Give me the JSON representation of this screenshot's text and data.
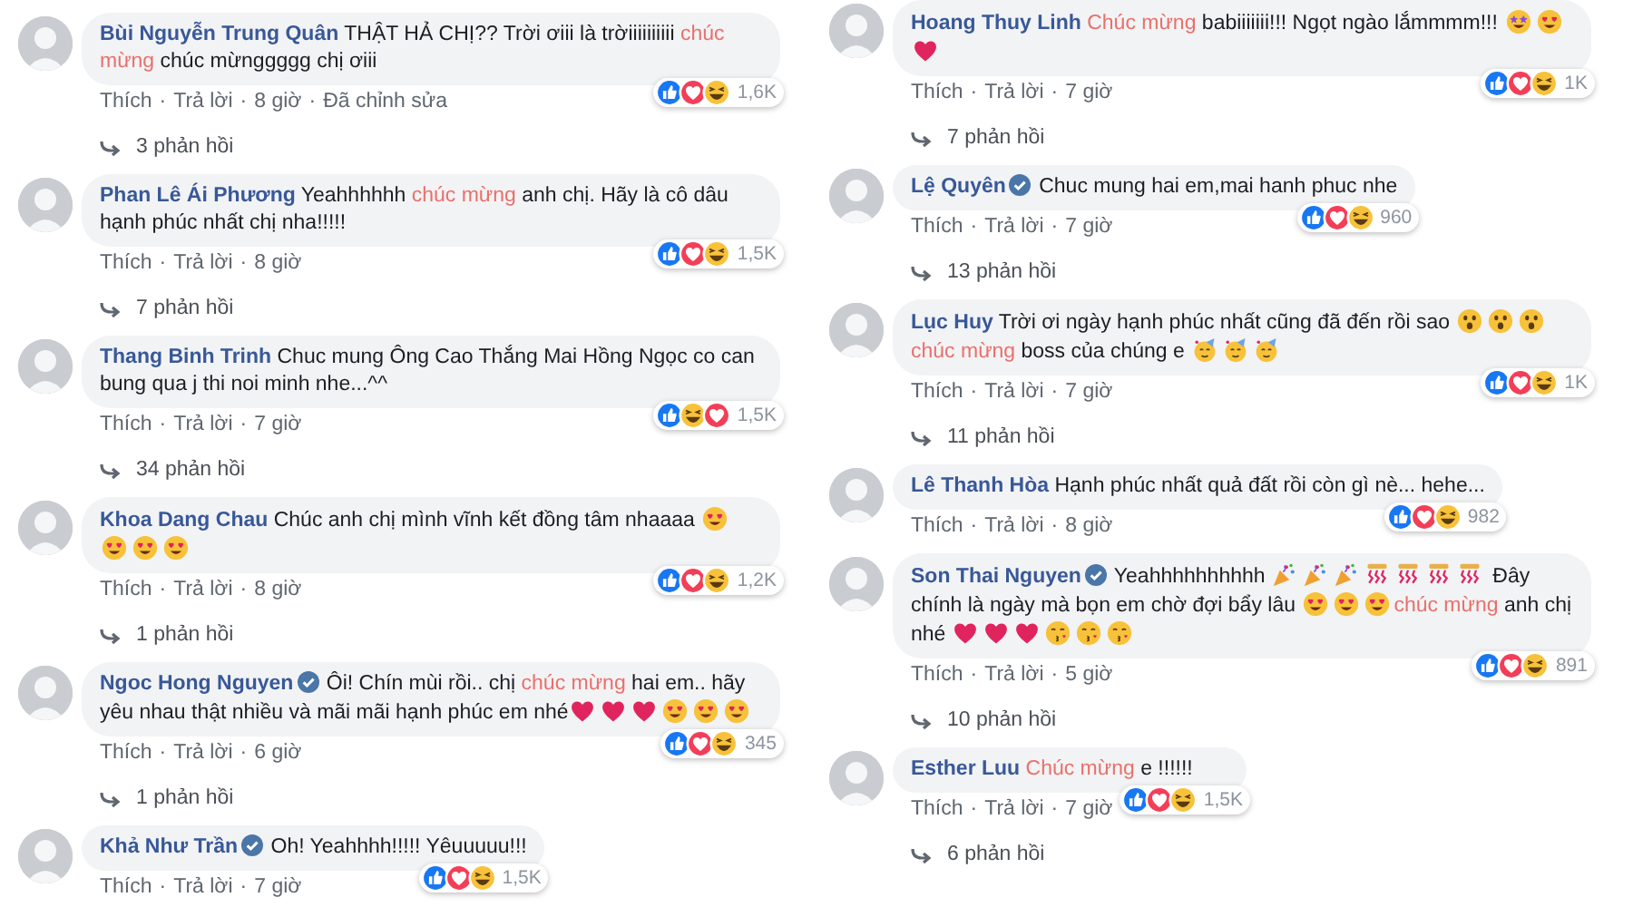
{
  "columns": [
    {
      "comments": [
        {
          "name": "Bùi Nguyễn Trung Quân",
          "verified": false,
          "body": [
            {
              "kind": "text",
              "text": "THẬT HẢ CHỊ?? Trời ơiii là trờiiiiiiiiii "
            },
            {
              "kind": "highlight",
              "text": "chúc mừng"
            },
            {
              "kind": "text",
              "text": " chúc mừnggggg chị ơiii"
            }
          ],
          "meta": [
            "Thích",
            "·",
            "Trả lời",
            "·",
            "8 giờ",
            "·",
            "Đã chỉnh sửa"
          ],
          "reactions": [
            {
              "kind": "like"
            },
            {
              "kind": "love"
            },
            {
              "kind": "haha"
            }
          ],
          "count": "1,6K",
          "replies": "3 phản hồi"
        },
        {
          "name": "Phan Lê Ái Phương",
          "verified": false,
          "body": [
            {
              "kind": "text",
              "text": "Yeahhhhhh "
            },
            {
              "kind": "highlight",
              "text": "chúc mừng"
            },
            {
              "kind": "text",
              "text": " anh chị. Hãy là cô dâu hạnh phúc nhất chị nha!!!!!"
            }
          ],
          "meta": [
            "Thích",
            "·",
            "Trả lời",
            "·",
            "8 giờ"
          ],
          "reactions": [
            {
              "kind": "like"
            },
            {
              "kind": "love"
            },
            {
              "kind": "haha"
            }
          ],
          "count": "1,5K",
          "replies": "7 phản hồi"
        },
        {
          "name": "Thang Binh Trinh",
          "verified": false,
          "body": [
            {
              "kind": "text",
              "text": "Chuc mung Ông Cao Thắng Mai Hồng Ngọc co can bung qua j thi noi minh nhe...^^"
            }
          ],
          "meta": [
            "Thích",
            "·",
            "Trả lời",
            "·",
            "7 giờ"
          ],
          "reactions": [
            {
              "kind": "like"
            },
            {
              "kind": "haha"
            },
            {
              "kind": "love"
            }
          ],
          "count": "1,5K",
          "replies": "34 phản hồi"
        },
        {
          "name": "Khoa Dang Chau",
          "verified": false,
          "body": [
            {
              "kind": "text",
              "text": "Chúc anh chị mình vĩnh kết đồng tâm nhaaaa "
            },
            {
              "kind": "heart-eyes"
            },
            {
              "kind": "heart-eyes"
            },
            {
              "kind": "heart-eyes"
            },
            {
              "kind": "heart-eyes"
            }
          ],
          "meta": [
            "Thích",
            "·",
            "Trả lời",
            "·",
            "8 giờ"
          ],
          "reactions": [
            {
              "kind": "like"
            },
            {
              "kind": "love"
            },
            {
              "kind": "haha"
            }
          ],
          "count": "1,2K",
          "replies": "1 phản hồi"
        },
        {
          "name": "Ngoc Hong Nguyen",
          "verified": true,
          "body": [
            {
              "kind": "text",
              "text": "Ôi! Chín mùi rồi.. chị "
            },
            {
              "kind": "highlight",
              "text": "chúc mừng"
            },
            {
              "kind": "text",
              "text": " hai em.. hãy yêu nhau thật nhiều và mãi mãi hạnh phúc em nhé"
            },
            {
              "kind": "heart"
            },
            {
              "kind": "heart"
            },
            {
              "kind": "heart"
            },
            {
              "kind": "heart-eyes"
            },
            {
              "kind": "heart-eyes"
            },
            {
              "kind": "heart-eyes"
            }
          ],
          "meta": [
            "Thích",
            "·",
            "Trả lời",
            "·",
            "6 giờ"
          ],
          "reactions": [
            {
              "kind": "like"
            },
            {
              "kind": "love"
            },
            {
              "kind": "haha"
            }
          ],
          "count": "345",
          "replies": "1 phản hồi"
        },
        {
          "name": "Khả Như Trần",
          "verified": true,
          "body": [
            {
              "kind": "text",
              "text": "Oh! Yeahhhh!!!!! Yêuuuuu!!!"
            }
          ],
          "meta": [
            "Thích",
            "·",
            "Trả lời",
            "·",
            "7 giờ"
          ],
          "reactions": [
            {
              "kind": "like"
            },
            {
              "kind": "love"
            },
            {
              "kind": "haha"
            }
          ],
          "count": "1,5K"
        }
      ]
    },
    {
      "comments": [
        {
          "name": "Hoang Thuy Linh",
          "verified": false,
          "body": [
            {
              "kind": "highlight",
              "text": "Chúc mừng"
            },
            {
              "kind": "text",
              "text": " babiiiiiii!!! Ngọt ngào lắmmmm!!! "
            },
            {
              "kind": "star-eyes"
            },
            {
              "kind": "heart-eyes"
            },
            {
              "kind": "heart"
            }
          ],
          "meta": [
            "Thích",
            "·",
            "Trả lời",
            "·",
            "7 giờ"
          ],
          "reactions": [
            {
              "kind": "like"
            },
            {
              "kind": "love"
            },
            {
              "kind": "haha"
            }
          ],
          "count": "1K",
          "replies": "7 phản hồi"
        },
        {
          "name": "Lệ Quyên",
          "verified": true,
          "body": [
            {
              "kind": "text",
              "text": "Chuc mung hai em,mai hanh phuc nhe"
            }
          ],
          "meta": [
            "Thích",
            "·",
            "Trả lời",
            "·",
            "7 giờ"
          ],
          "reactions": [
            {
              "kind": "like"
            },
            {
              "kind": "love"
            },
            {
              "kind": "haha"
            }
          ],
          "count": "960",
          "replies": "13 phản hồi"
        },
        {
          "name": "Lục Huy",
          "verified": false,
          "body": [
            {
              "kind": "text",
              "text": "Trời ơi ngày hạnh phúc nhất cũng đã đến rồi sao "
            },
            {
              "kind": "wow"
            },
            {
              "kind": "wow"
            },
            {
              "kind": "wow"
            },
            {
              "kind": "highlight",
              "text": "chúc mừng"
            },
            {
              "kind": "text",
              "text": " boss của chúng e "
            },
            {
              "kind": "party"
            },
            {
              "kind": "party"
            },
            {
              "kind": "party"
            }
          ],
          "meta": [
            "Thích",
            "·",
            "Trả lời",
            "·",
            "7 giờ"
          ],
          "reactions": [
            {
              "kind": "like"
            },
            {
              "kind": "love"
            },
            {
              "kind": "haha"
            }
          ],
          "count": "1K",
          "replies": "11 phản hồi"
        },
        {
          "name": "Lê Thanh Hòa",
          "verified": false,
          "body": [
            {
              "kind": "text",
              "text": "Hạnh phúc nhất quả đất rồi còn gì nè... hehe..."
            }
          ],
          "meta": [
            "Thích",
            "·",
            "Trả lời",
            "·",
            "8 giờ"
          ],
          "reactions": [
            {
              "kind": "like"
            },
            {
              "kind": "love"
            },
            {
              "kind": "haha"
            }
          ],
          "count": "982"
        },
        {
          "name": "Son Thai Nguyen",
          "verified": true,
          "body": [
            {
              "kind": "text",
              "text": "Yeahhhhhhhhhh "
            },
            {
              "kind": "popper"
            },
            {
              "kind": "popper"
            },
            {
              "kind": "popper"
            },
            {
              "kind": "streamer"
            },
            {
              "kind": "streamer"
            },
            {
              "kind": "streamer"
            },
            {
              "kind": "streamer"
            },
            {
              "kind": "text",
              "text": " Đây chính là ngày mà bọn em chờ đợi bẩy lâu "
            },
            {
              "kind": "heart-eyes"
            },
            {
              "kind": "heart-eyes"
            },
            {
              "kind": "heart-eyes"
            },
            {
              "kind": "highlight",
              "text": "chúc mừng"
            },
            {
              "kind": "text",
              "text": " anh chị nhé "
            },
            {
              "kind": "heart"
            },
            {
              "kind": "heart"
            },
            {
              "kind": "heart"
            },
            {
              "kind": "kiss"
            },
            {
              "kind": "kiss"
            },
            {
              "kind": "kiss"
            }
          ],
          "meta": [
            "Thích",
            "·",
            "Trả lời",
            "·",
            "5 giờ"
          ],
          "reactions": [
            {
              "kind": "like"
            },
            {
              "kind": "love"
            },
            {
              "kind": "haha"
            }
          ],
          "count": "891",
          "replies": "10 phản hồi"
        },
        {
          "name": "Esther Luu",
          "verified": false,
          "body": [
            {
              "kind": "highlight",
              "text": "Chúc mừng"
            },
            {
              "kind": "text",
              "text": " e !!!!!!"
            }
          ],
          "meta": [
            "Thích",
            "·",
            "Trả lời",
            "·",
            "7 giờ"
          ],
          "reactions": [
            {
              "kind": "like"
            },
            {
              "kind": "love"
            },
            {
              "kind": "haha"
            }
          ],
          "count": "1,5K",
          "replies": "6 phản hồi"
        }
      ]
    }
  ]
}
